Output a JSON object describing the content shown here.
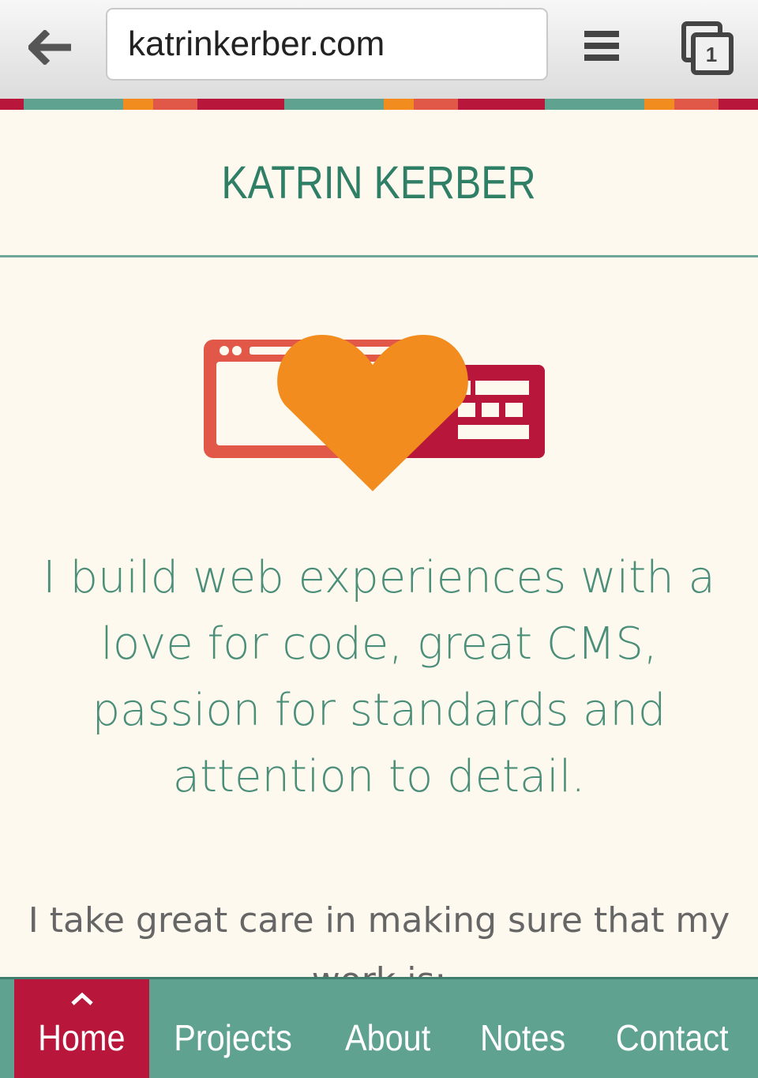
{
  "browser": {
    "url": "katrinkerber.com",
    "tab_count": "1"
  },
  "site": {
    "title": "KATRIN KERBER"
  },
  "main": {
    "intro": "I build web experiences with a love for code, great CMS, passion for standards and attention to detail.",
    "lead": "I take great care in making sure that my work is:"
  },
  "nav": {
    "items": [
      {
        "label": "Home",
        "active": true
      },
      {
        "label": "Projects"
      },
      {
        "label": "About"
      },
      {
        "label": "Notes"
      },
      {
        "label": "Contact"
      }
    ]
  },
  "colors": {
    "teal": "#5fa290",
    "crimson": "#b8163a",
    "orange": "#f28c1e",
    "coral": "#e25848",
    "background": "#fdf9ee",
    "title_green": "#2f7e66"
  }
}
